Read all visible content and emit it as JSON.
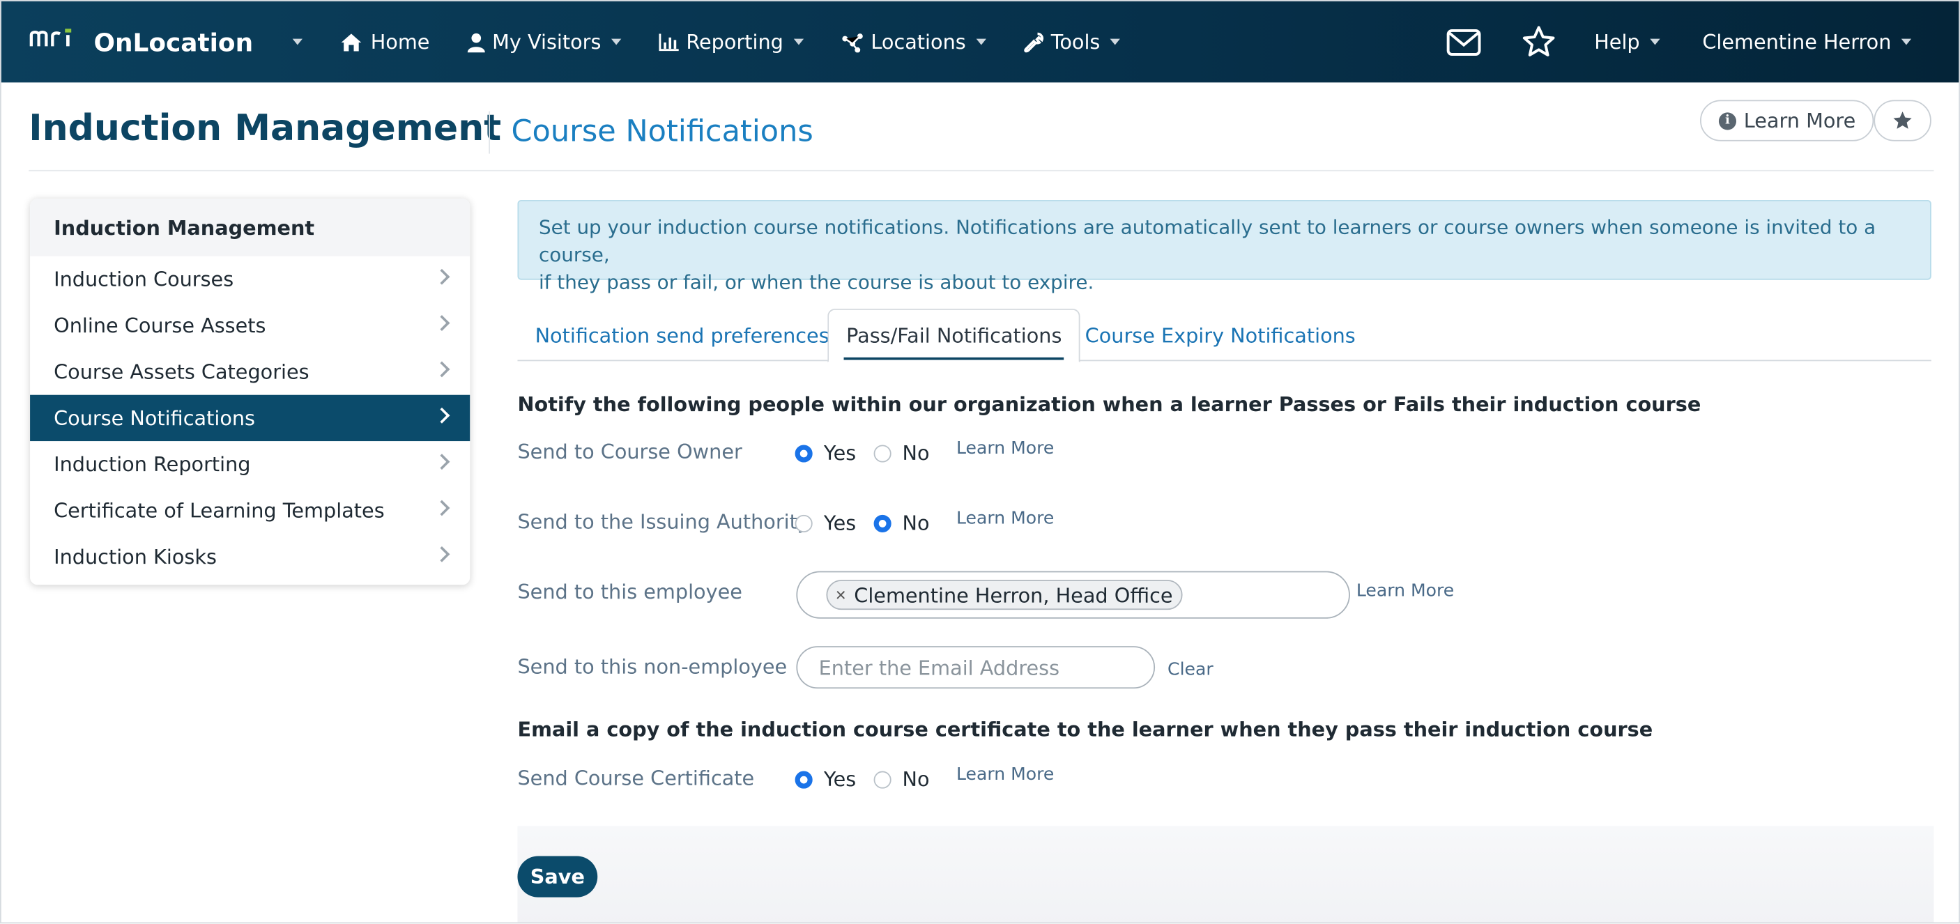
{
  "nav": {
    "logo_text": "mri",
    "brand": "OnLocation",
    "items": [
      {
        "label": "Home",
        "icon": "home-icon"
      },
      {
        "label": "My Visitors",
        "icon": "user-icon"
      },
      {
        "label": "Reporting",
        "icon": "bar-chart-icon"
      },
      {
        "label": "Locations",
        "icon": "network-icon"
      },
      {
        "label": "Tools",
        "icon": "wrench-icon"
      }
    ],
    "help": "Help",
    "user": "Clementine Herron",
    "bg_color": "#0b3f5c"
  },
  "header": {
    "title": "Induction Management",
    "subtitle": "Course Notifications",
    "learn_more": "Learn More"
  },
  "sidebar": {
    "heading": "Induction Management",
    "items": [
      {
        "label": "Induction Courses"
      },
      {
        "label": "Online Course Assets"
      },
      {
        "label": "Course Assets Categories"
      },
      {
        "label": "Course Notifications",
        "active": true
      },
      {
        "label": "Induction Reporting"
      },
      {
        "label": "Certificate of Learning Templates"
      },
      {
        "label": "Induction Kiosks"
      }
    ],
    "active_color": "#0b4b6b"
  },
  "alert": {
    "line1": "Set up your induction course notifications. Notifications are automatically sent to learners or course owners when someone is invited to a course,",
    "line2": "if they pass or fail, or when the course is about to expire."
  },
  "tabs": [
    {
      "label": "Notification send preferences"
    },
    {
      "label": "Pass/Fail Notifications",
      "active": true
    },
    {
      "label": "Course Expiry Notifications"
    }
  ],
  "form": {
    "section1_heading": "Notify the following people within our organization when a learner Passes or Fails their induction course",
    "course_owner": {
      "label": "Send to Course Owner",
      "yes": "Yes",
      "no": "No",
      "selected": "Yes",
      "learn_more": "Learn More"
    },
    "issuing_authority": {
      "label": "Send to the Issuing Authority",
      "yes": "Yes",
      "no": "No",
      "selected": "No",
      "learn_more": "Learn More"
    },
    "employee": {
      "label": "Send to this employee",
      "tag": "Clementine Herron, Head Office",
      "learn_more": "Learn More"
    },
    "non_employee": {
      "label": "Send to this non-employee",
      "placeholder": "Enter the Email Address",
      "value": "",
      "clear": "Clear"
    },
    "section2_heading": "Email a copy of the induction course certificate to the learner when they pass their induction course",
    "certificate": {
      "label": "Send Course Certificate",
      "yes": "Yes",
      "no": "No",
      "selected": "Yes",
      "learn_more": "Learn More"
    },
    "save": "Save"
  }
}
